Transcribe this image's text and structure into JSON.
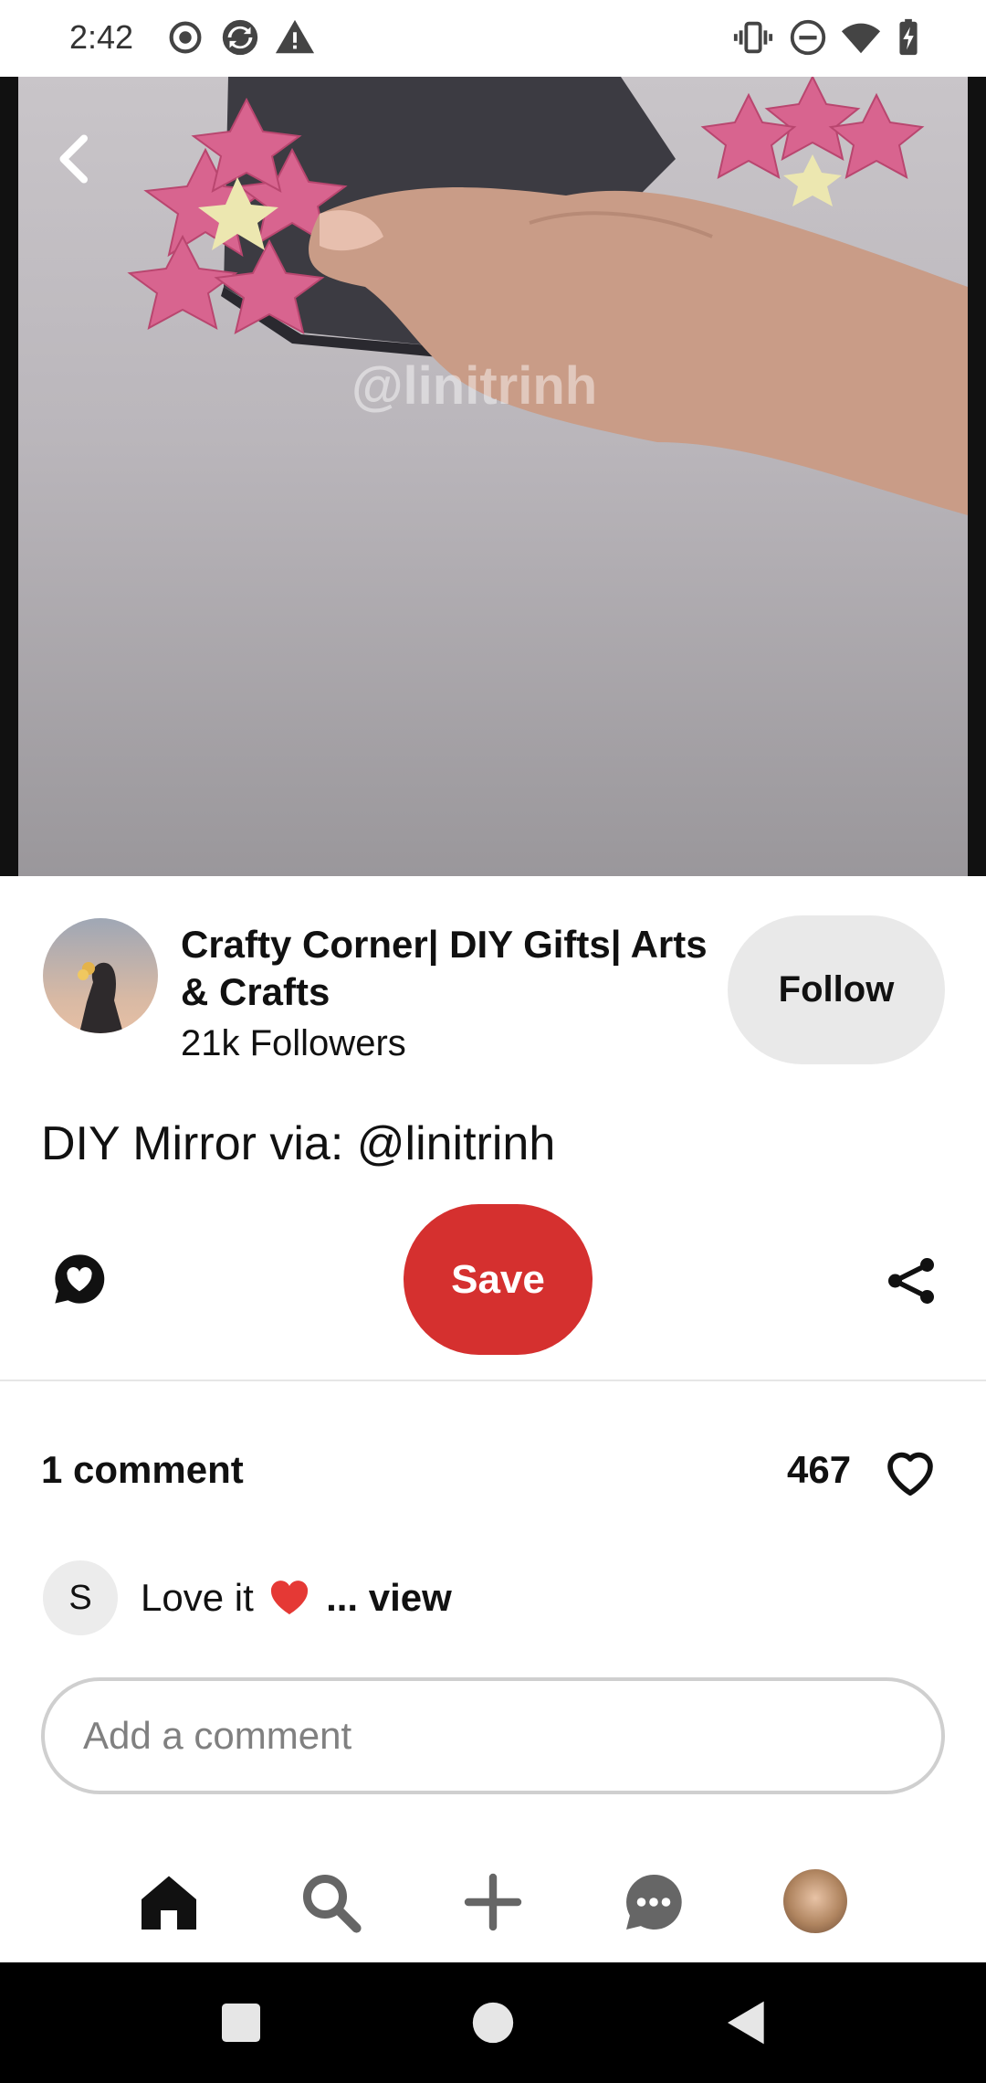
{
  "status_bar": {
    "time": "2:42",
    "icons": [
      "record-icon",
      "sync-icon",
      "warning-icon",
      "vibrate-icon",
      "do-not-disturb-icon",
      "wifi-icon",
      "battery-charging-icon"
    ]
  },
  "media": {
    "watermark": "@linitrinh",
    "back_icon": "chevron-left-icon"
  },
  "creator": {
    "name": "Crafty Corner| DIY Gifts| Arts & Crafts",
    "followers": "21k Followers",
    "follow_label": "Follow"
  },
  "pin": {
    "title": "DIY Mirror via: @linitrinh"
  },
  "actions": {
    "save_label": "Save",
    "comment_icon": "comment-heart-icon",
    "share_icon": "share-icon"
  },
  "comments": {
    "count_label": "1 comment",
    "likes": "467",
    "preview": {
      "avatar_initial": "S",
      "text": "Love it",
      "more": " ... view"
    },
    "input_placeholder": "Add a comment"
  },
  "bottom_nav": [
    "home-icon",
    "search-icon",
    "create-icon",
    "messages-icon",
    "profile-avatar"
  ],
  "colors": {
    "accent": "#d5302f",
    "follow_bg": "#e9e9e9",
    "text": "#111111"
  }
}
